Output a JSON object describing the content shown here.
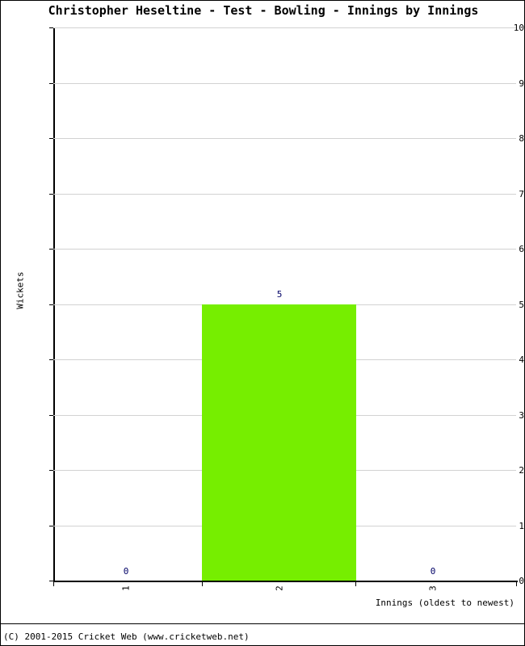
{
  "chart_data": {
    "type": "bar",
    "title": "Christopher Heseltine - Test - Bowling - Innings by Innings",
    "xlabel": "Innings (oldest to newest)",
    "ylabel": "Wickets",
    "categories": [
      "1",
      "2",
      "3"
    ],
    "values": [
      0,
      5,
      0
    ],
    "data_labels": [
      "0",
      "5",
      "0"
    ],
    "ylim": [
      0,
      10
    ],
    "yticks": [
      "10",
      "9",
      "8",
      "7",
      "6",
      "5",
      "4",
      "3",
      "2",
      "1",
      "0"
    ],
    "ytick_values": [
      10,
      9,
      8,
      7,
      6,
      5,
      4,
      3,
      2,
      1,
      0
    ],
    "grid": true,
    "legend": "none",
    "series": [
      {
        "name": "Wickets",
        "values": [
          0,
          5,
          0
        ],
        "color": "#76EE00"
      }
    ],
    "colors": {
      "bar": "#76EE00",
      "grid": "#D2D2D2",
      "axis": "#000000",
      "data_label": "#000066",
      "background": "#FFFFFF"
    }
  },
  "footer": {
    "copyright": "(C) 2001-2015 Cricket Web (www.cricketweb.net)"
  }
}
